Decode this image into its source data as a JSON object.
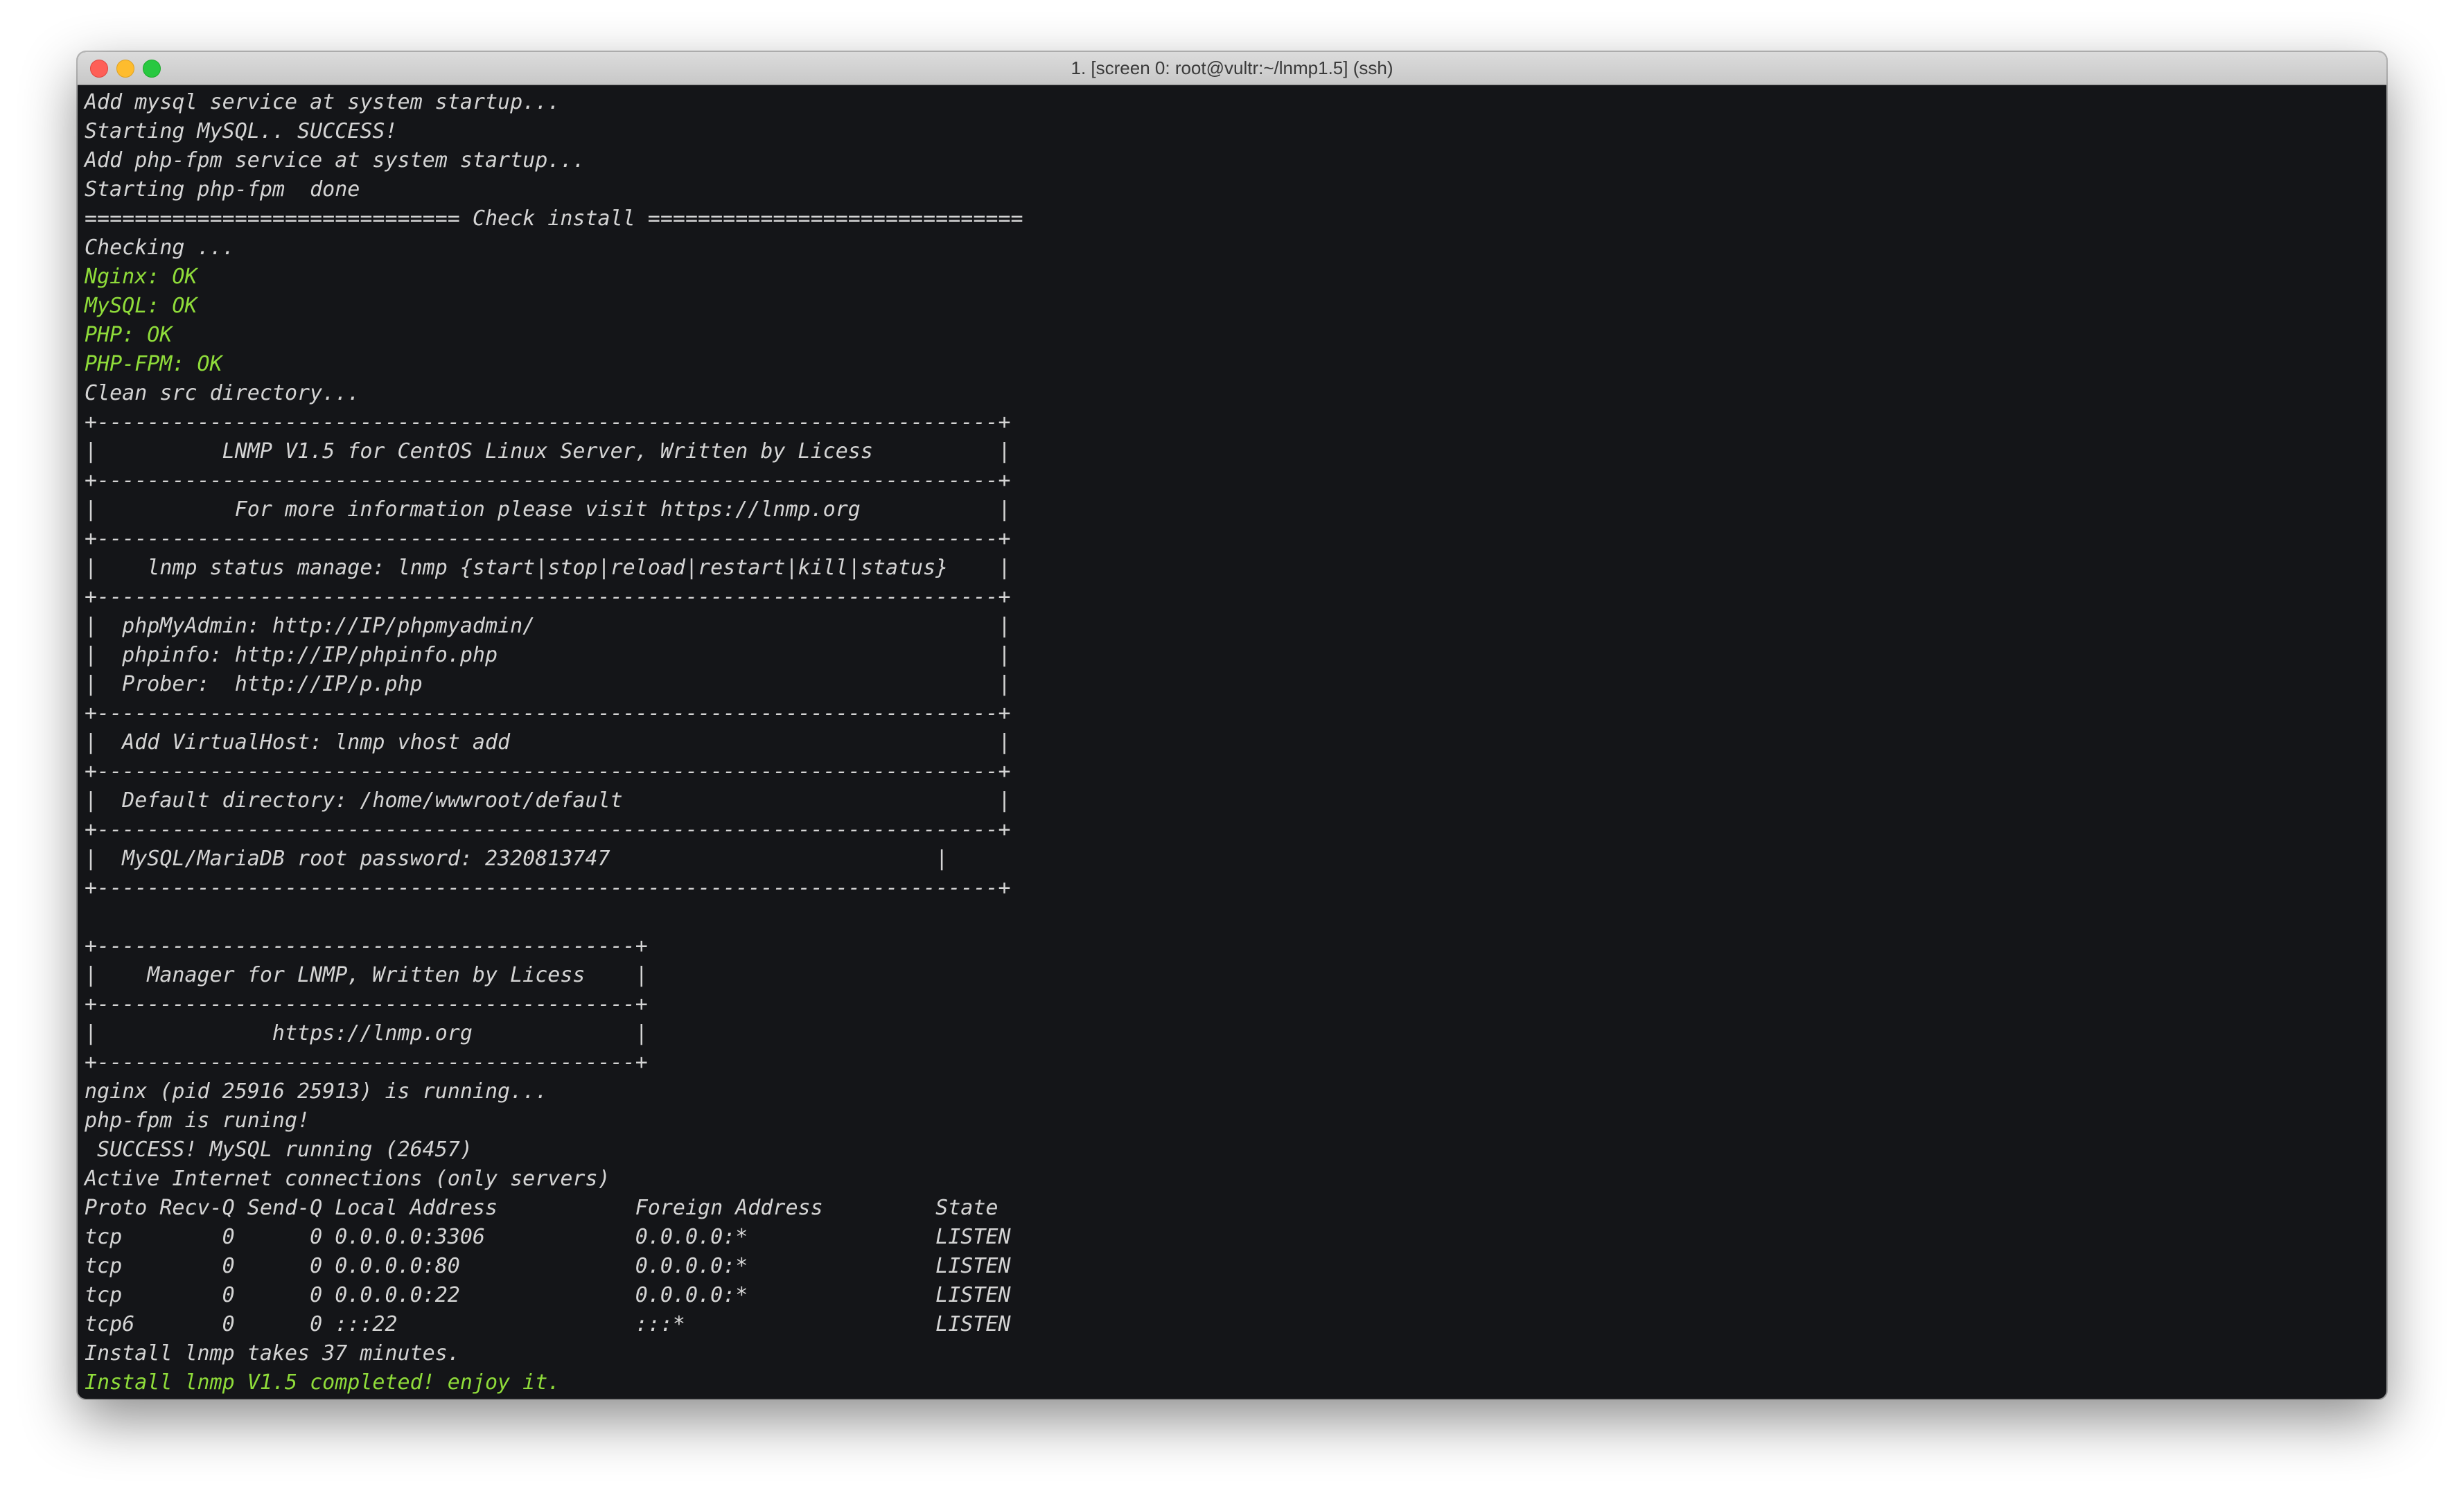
{
  "window": {
    "title": "1. [screen 0: root@vultr:~/lnmp1.5]  (ssh)"
  },
  "terminal": {
    "lines": [
      {
        "text": "Add mysql service at system startup...",
        "color": "default"
      },
      {
        "text": "Starting MySQL.. SUCCESS!",
        "color": "default"
      },
      {
        "text": "Add php-fpm service at system startup...",
        "color": "default"
      },
      {
        "text": "Starting php-fpm  done",
        "color": "default"
      },
      {
        "text": "============================== Check install ==============================",
        "color": "default"
      },
      {
        "text": "Checking ...",
        "color": "default"
      },
      {
        "text": "Nginx: OK",
        "color": "green"
      },
      {
        "text": "MySQL: OK",
        "color": "green"
      },
      {
        "text": "PHP: OK",
        "color": "green"
      },
      {
        "text": "PHP-FPM: OK",
        "color": "green"
      },
      {
        "text": "Clean src directory...",
        "color": "default"
      },
      {
        "text": "+------------------------------------------------------------------------+",
        "color": "default"
      },
      {
        "text": "|          LNMP V1.5 for CentOS Linux Server, Written by Licess          |",
        "color": "default"
      },
      {
        "text": "+------------------------------------------------------------------------+",
        "color": "default"
      },
      {
        "text": "|           For more information please visit https://lnmp.org           |",
        "color": "default"
      },
      {
        "text": "+------------------------------------------------------------------------+",
        "color": "default"
      },
      {
        "text": "|    lnmp status manage: lnmp {start|stop|reload|restart|kill|status}    |",
        "color": "default"
      },
      {
        "text": "+------------------------------------------------------------------------+",
        "color": "default"
      },
      {
        "text": "|  phpMyAdmin: http://IP/phpmyadmin/                                     |",
        "color": "default"
      },
      {
        "text": "|  phpinfo: http://IP/phpinfo.php                                        |",
        "color": "default"
      },
      {
        "text": "|  Prober:  http://IP/p.php                                              |",
        "color": "default"
      },
      {
        "text": "+------------------------------------------------------------------------+",
        "color": "default"
      },
      {
        "text": "|  Add VirtualHost: lnmp vhost add                                       |",
        "color": "default"
      },
      {
        "text": "+------------------------------------------------------------------------+",
        "color": "default"
      },
      {
        "text": "|  Default directory: /home/wwwroot/default                              |",
        "color": "default"
      },
      {
        "text": "+------------------------------------------------------------------------+",
        "color": "default"
      },
      {
        "text": "|  MySQL/MariaDB root password: 2320813747                          |",
        "color": "default"
      },
      {
        "text": "+------------------------------------------------------------------------+",
        "color": "default"
      },
      {
        "text": "",
        "color": "default"
      },
      {
        "text": "+-------------------------------------------+",
        "color": "default"
      },
      {
        "text": "|    Manager for LNMP, Written by Licess    |",
        "color": "default"
      },
      {
        "text": "+-------------------------------------------+",
        "color": "default"
      },
      {
        "text": "|              https://lnmp.org             |",
        "color": "default"
      },
      {
        "text": "+-------------------------------------------+",
        "color": "default"
      },
      {
        "text": "nginx (pid 25916 25913) is running...",
        "color": "default"
      },
      {
        "text": "php-fpm is runing!",
        "color": "default"
      },
      {
        "text": " SUCCESS! MySQL running (26457)",
        "color": "default"
      },
      {
        "text": "Active Internet connections (only servers)",
        "color": "default"
      },
      {
        "text": "Proto Recv-Q Send-Q Local Address           Foreign Address         State",
        "color": "default"
      },
      {
        "text": "tcp        0      0 0.0.0.0:3306            0.0.0.0:*               LISTEN",
        "color": "default"
      },
      {
        "text": "tcp        0      0 0.0.0.0:80              0.0.0.0:*               LISTEN",
        "color": "default"
      },
      {
        "text": "tcp        0      0 0.0.0.0:22              0.0.0.0:*               LISTEN",
        "color": "default"
      },
      {
        "text": "tcp6       0      0 :::22                   :::*                    LISTEN",
        "color": "default"
      },
      {
        "text": "Install lnmp takes 37 minutes.",
        "color": "default"
      },
      {
        "text": "Install lnmp V1.5 completed! enjoy it.",
        "color": "green"
      }
    ],
    "cursor": "_"
  },
  "colors": {
    "background": "#141518",
    "text": "#d4d4d4",
    "green": "#8fdc3a"
  },
  "icons": {
    "close": "close-traffic-light-icon",
    "minimize": "minimize-traffic-light-icon",
    "maximize": "maximize-traffic-light-icon"
  }
}
